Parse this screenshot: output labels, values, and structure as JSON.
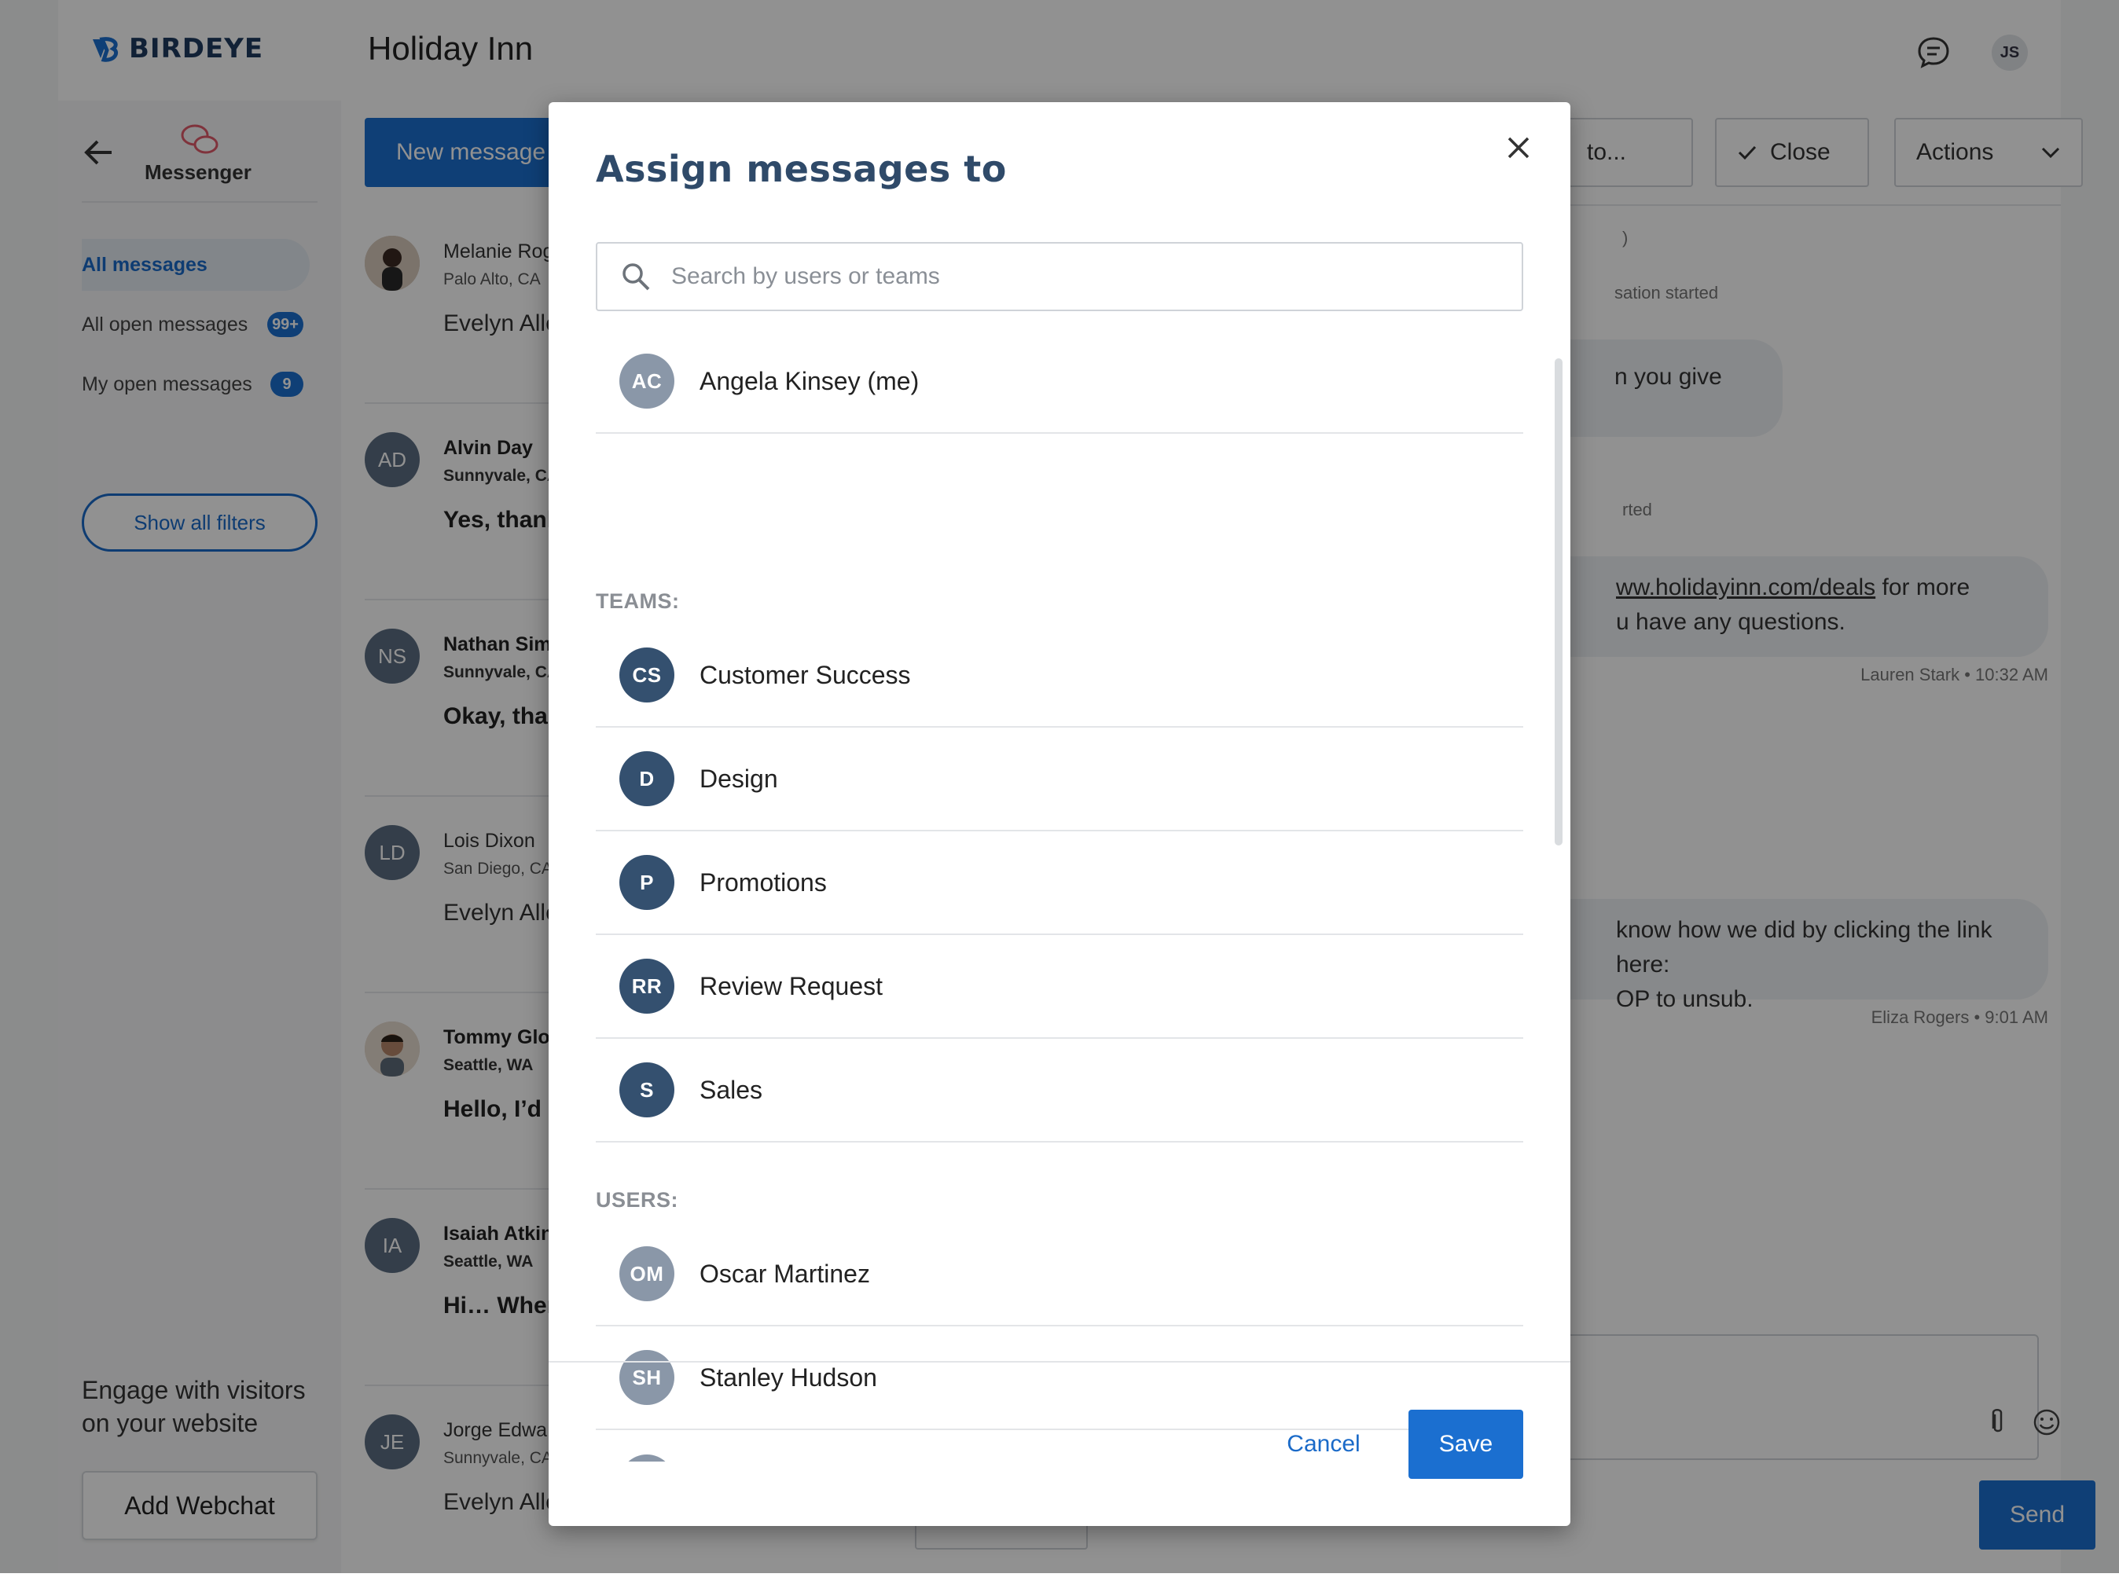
{
  "app": {
    "brand": "BIRDEYE",
    "location_title": "Holiday Inn",
    "user_initials": "JS"
  },
  "sidebar": {
    "messenger_label": "Messenger",
    "nav": [
      {
        "label": "All messages",
        "badge": ""
      },
      {
        "label": "All open messages",
        "badge": "99+"
      },
      {
        "label": "My open messages",
        "badge": "9"
      }
    ],
    "show_filters": "Show all filters",
    "engage_text": "Engage with visitors on your website",
    "add_webchat": "Add Webchat"
  },
  "list": {
    "new_message": "New message",
    "conversations": [
      {
        "initials": "",
        "name": "Melanie Rog",
        "location": "Palo Alto, CA",
        "preview": "Evelyn Alle what you t",
        "unread": false
      },
      {
        "initials": "AD",
        "name": "Alvin Day",
        "location": "Sunnyvale, CA",
        "preview": "Yes, thank I’m good.",
        "unread": true
      },
      {
        "initials": "NS",
        "name": "Nathan Sim",
        "location": "Sunnyvale, CA",
        "preview": "Okay, thar",
        "unread": true
      },
      {
        "initials": "LD",
        "name": "Lois Dixon",
        "location": "San Diego, CA",
        "preview": "Evelyn Alle if you kno",
        "unread": false
      },
      {
        "initials": "",
        "name": "Tommy Glo",
        "location": "Seattle, WA",
        "preview": "Hello, I’d l Wednesda",
        "unread": true
      },
      {
        "initials": "IA",
        "name": "Isaiah Atkin",
        "location": "Seattle, WA",
        "preview": "Hi… When",
        "unread": true
      },
      {
        "initials": "JE",
        "name": "Jorge Edwa",
        "location": "Sunnyvale, CA",
        "preview": "Evelyn Alle",
        "unread": false
      }
    ]
  },
  "detail": {
    "assign_btn": "to...",
    "close_btn": "Close",
    "actions_btn": "Actions",
    "sys1": ")",
    "sys2": "sation started",
    "bubble1": "n you give",
    "sys3": "rted",
    "bubble2_link": "ww.holidayinn.com/deals",
    "bubble2_rest": " for more",
    "bubble2_line2": "u have any questions.",
    "meta2": "Lauren Stark • 10:32 AM",
    "bubble3_line1": "know how we did by clicking the link here:",
    "bubble3_line2": "OP to unsub.",
    "meta3": "Eliza Rogers • 9:01 AM",
    "send": "Send"
  },
  "modal": {
    "title": "Assign messages to",
    "search_placeholder": "Search by users or teams",
    "me": {
      "initials": "AC",
      "name": "Angela Kinsey (me)"
    },
    "teams_label": "TEAMS:",
    "teams": [
      {
        "initials": "CS",
        "name": "Customer Success"
      },
      {
        "initials": "D",
        "name": "Design"
      },
      {
        "initials": "P",
        "name": "Promotions"
      },
      {
        "initials": "RR",
        "name": "Review Request"
      },
      {
        "initials": "S",
        "name": "Sales"
      }
    ],
    "users_label": "USERS:",
    "users": [
      {
        "initials": "OM",
        "name": "Oscar Martinez"
      },
      {
        "initials": "SH",
        "name": "Stanley Hudson"
      }
    ],
    "cancel": "Cancel",
    "save": "Save"
  }
}
